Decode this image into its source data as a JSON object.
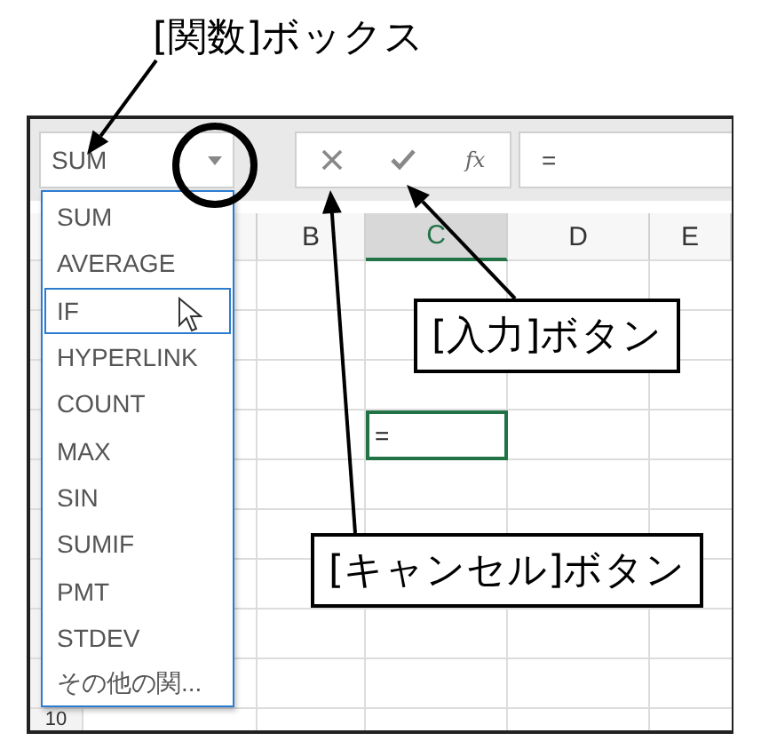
{
  "name_box": {
    "value": "SUM"
  },
  "formula_bar": {
    "function_label": "fx",
    "formula": "="
  },
  "columns": [
    {
      "label": "B",
      "selected": false
    },
    {
      "label": "C",
      "selected": true
    },
    {
      "label": "D",
      "selected": false
    },
    {
      "label": "E",
      "selected": false
    }
  ],
  "active_cell": {
    "value": "="
  },
  "last_row_number": "10",
  "function_list": [
    {
      "label": "SUM",
      "selected": false
    },
    {
      "label": "AVERAGE",
      "selected": false
    },
    {
      "label": "IF",
      "selected": true
    },
    {
      "label": "HYPERLINK",
      "selected": false
    },
    {
      "label": "COUNT",
      "selected": false
    },
    {
      "label": "MAX",
      "selected": false
    },
    {
      "label": "SIN",
      "selected": false
    },
    {
      "label": "SUMIF",
      "selected": false
    },
    {
      "label": "PMT",
      "selected": false
    },
    {
      "label": "STDEV",
      "selected": false
    },
    {
      "label": "その他の関...",
      "selected": false
    }
  ],
  "callouts": [
    {
      "text": "[関数]ボックス",
      "kind": "plain"
    },
    {
      "text": "[入力]ボタン",
      "kind": "boxed"
    },
    {
      "text": "[キャンセル]ボタン",
      "kind": "boxed"
    }
  ]
}
